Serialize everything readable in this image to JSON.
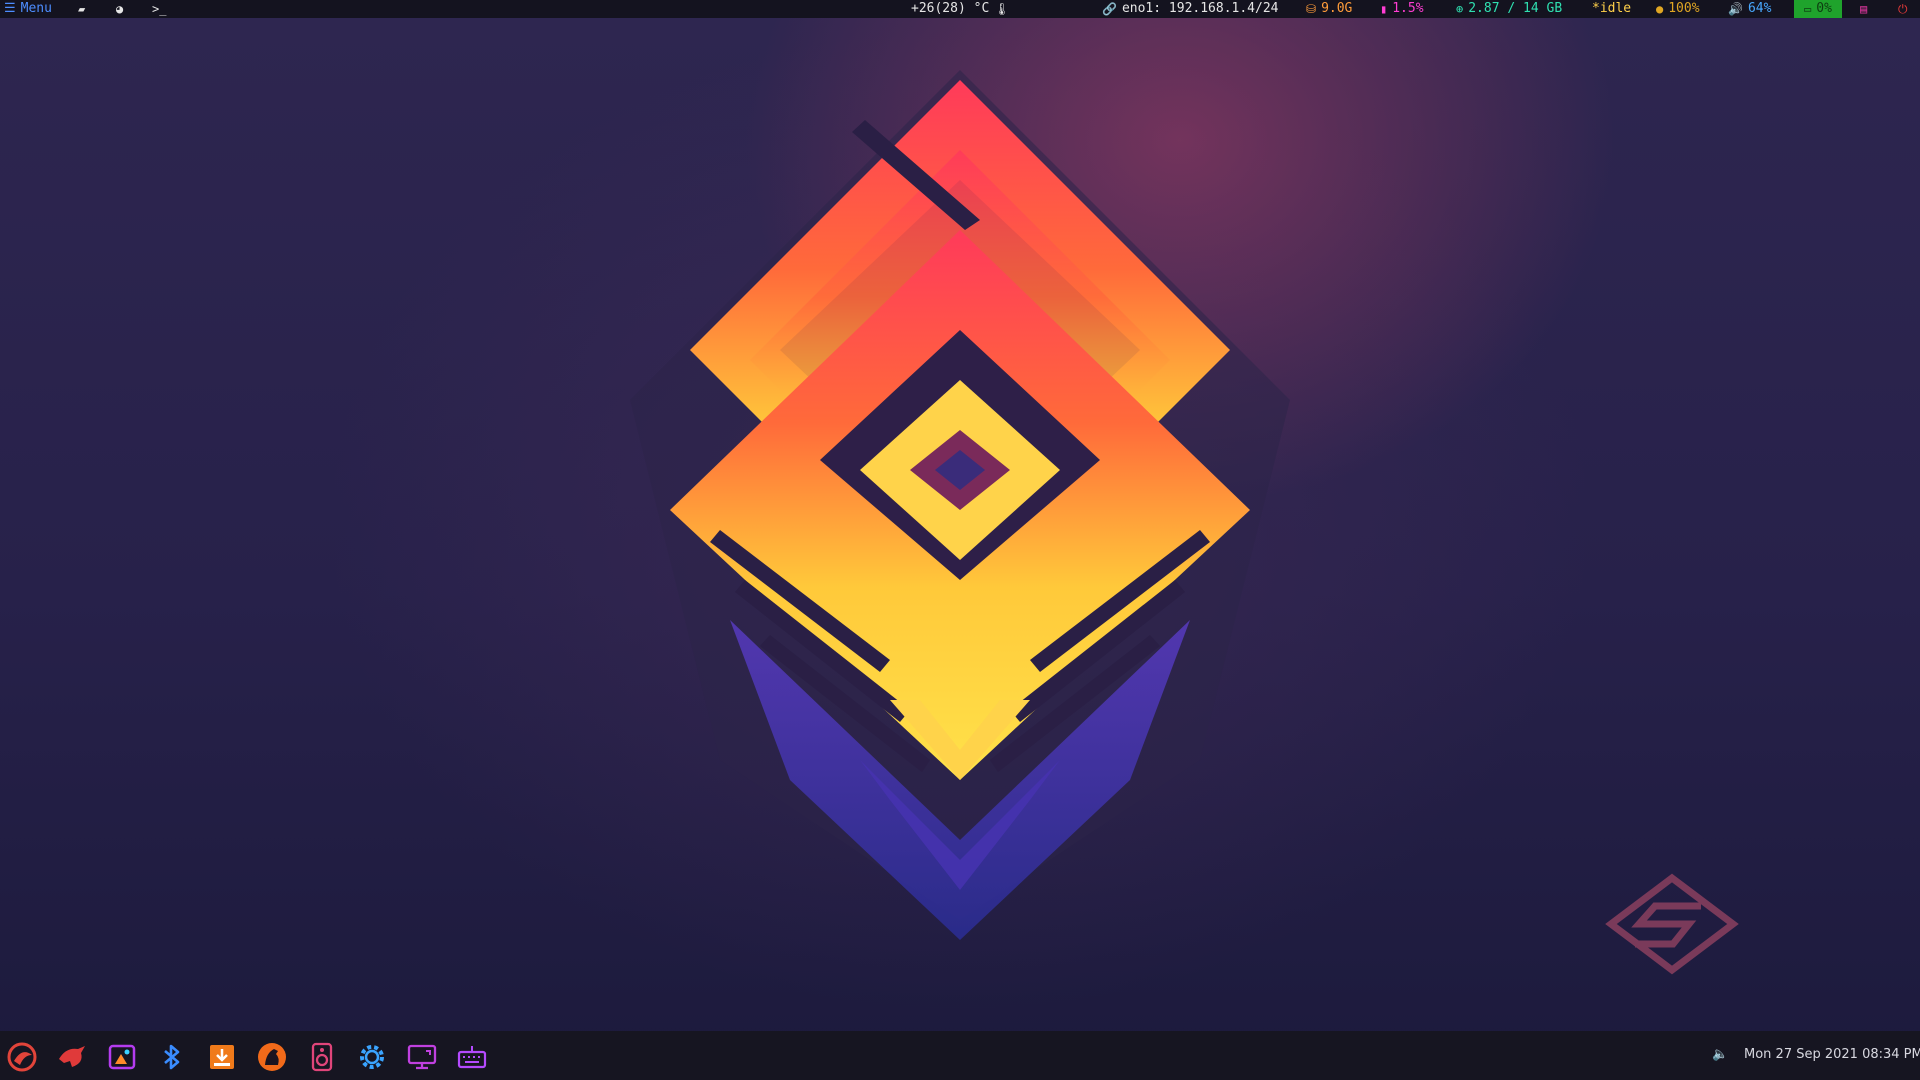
{
  "topbar": {
    "menu_label": "Menu",
    "temperature": "+26(28) °C",
    "network": "eno1: 192.168.1.4/24",
    "disk": "9.0G",
    "cpu": "1.5%",
    "memory": "2.87 / 14 GB",
    "mpd_state": "*idle",
    "brightness": "100%",
    "volume": "64%",
    "battery": "0%",
    "icons": {
      "menu": "hamburger-icon",
      "files": "folder-open-icon",
      "browser": "firefox-icon",
      "terminal": "terminal-icon",
      "temperature": "thermometer-icon",
      "network": "link-icon",
      "disk": "drive-icon",
      "cpu": "chip-icon",
      "memory": "memory-icon",
      "brightness": "sun-icon",
      "volume": "speaker-icon",
      "battery": "battery-icon",
      "system_menu": "app-grid-icon",
      "power": "power-icon"
    },
    "colors": {
      "bar_bg": "#14131f",
      "menu": "#4d8dff",
      "disk": "#ff9c3a",
      "cpu": "#ff3dd3",
      "memory": "#2fe0b0",
      "mpd": "#ffd04a",
      "brightness": "#e0a623",
      "volume": "#48a8ff",
      "battery_bg": "#1fa32c",
      "power": "#e83a3a"
    }
  },
  "dock": {
    "apps": [
      {
        "icon": "archcraft-logo-icon"
      },
      {
        "icon": "red-bird-icon"
      },
      {
        "icon": "image-viewer-icon"
      },
      {
        "icon": "bluetooth-icon"
      },
      {
        "icon": "download-installer-icon"
      },
      {
        "icon": "horse-browser-icon"
      },
      {
        "icon": "speaker-audio-icon"
      },
      {
        "icon": "settings-gear-icon"
      },
      {
        "icon": "display-settings-icon"
      },
      {
        "icon": "keyboard-icon"
      }
    ],
    "tray": {
      "volume_icon": "speaker-icon",
      "clock": "Mon 27 Sep 2021 08:34 PM"
    }
  },
  "desktop": {
    "wallpaper": "abstract-glitch-diamond-wallpaper",
    "watermark": "archcraft-logo"
  }
}
